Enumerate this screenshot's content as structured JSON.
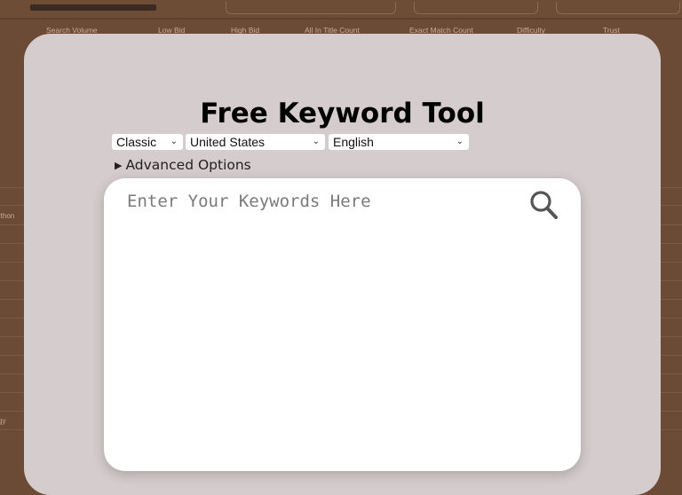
{
  "background_table": {
    "headers": [
      "Search Volume",
      "Low Bid",
      "High Bid",
      "All In Title Count",
      "Exact Match Count",
      "Difficulty",
      "Trust"
    ],
    "partial_rows": [
      "rthon",
      "gy"
    ]
  },
  "modal": {
    "title": "Free Keyword Tool",
    "mode_select": "Classic",
    "country_select": "United States",
    "language_select": "English",
    "advanced_options": "Advanced Options",
    "keyword_placeholder": "Enter Your Keywords Here"
  },
  "colors": {
    "background": "#6c4b36",
    "modal": "#d5cdcd",
    "input": "#ffffff"
  }
}
